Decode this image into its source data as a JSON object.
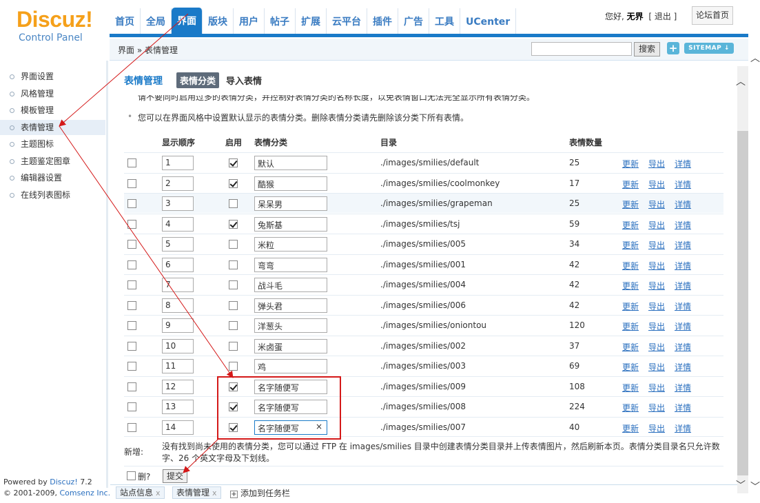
{
  "header": {
    "logo_main": "Discuz!",
    "logo_sub": "Control Panel",
    "nav": [
      "首页",
      "全局",
      "界面",
      "版块",
      "用户",
      "帖子",
      "扩展",
      "云平台",
      "插件",
      "广告",
      "工具",
      "UCenter"
    ],
    "active_nav": "界面",
    "greeting": "您好,",
    "username": "无界",
    "logout_open": "[",
    "logout": "退出",
    "logout_close": "]",
    "forum_home": "论坛首页",
    "accent_color": "#1a7ac8"
  },
  "toolbar": {
    "breadcrumb": "界面 » 表情管理",
    "search_value": "",
    "search_button": "搜索",
    "add_icon": "plus-icon",
    "add_glyph": "+",
    "sitemap": "SITEMAP ↓"
  },
  "sidebar": {
    "items": [
      "界面设置",
      "风格管理",
      "模板管理",
      "表情管理",
      "主题图标",
      "主题鉴定图章",
      "编辑器设置",
      "在线列表图标"
    ],
    "active": "表情管理",
    "powered_prefix": "Powered by",
    "powered_brand": "Discuz!",
    "powered_version": "7.2",
    "copyright_prefix": "© 2001-2009,",
    "copyright_brand": "Comsenz Inc."
  },
  "main": {
    "title": "表情管理",
    "tab_active": "表情分类",
    "tab_other": "导入表情",
    "tip1": "请不要同时启用过多的表情分类，并控制好表情分类的名称长度，以免表情窗口无法完全显示所有表情分类。",
    "tip2": "您可以在界面风格中设置默认显示的表情分类。删除表情分类请先删除该分类下所有表情。",
    "columns": [
      "显示顺序",
      "启用",
      "表情分类",
      "目录",
      "表情数量"
    ],
    "actions": [
      "更新",
      "导出",
      "详情"
    ],
    "rows": [
      {
        "order": "1",
        "enabled": true,
        "name": "默认",
        "dir": "./images/smilies/default",
        "count": "25"
      },
      {
        "order": "2",
        "enabled": true,
        "name": "酷猴",
        "dir": "./images/smilies/coolmonkey",
        "count": "17"
      },
      {
        "order": "3",
        "enabled": false,
        "name": "呆呆男",
        "dir": "./images/smilies/grapeman",
        "count": "25"
      },
      {
        "order": "4",
        "enabled": true,
        "name": "兔斯基",
        "dir": "./images/smilies/tsj",
        "count": "59"
      },
      {
        "order": "5",
        "enabled": false,
        "name": "米粒",
        "dir": "./images/smilies/005",
        "count": "34"
      },
      {
        "order": "6",
        "enabled": false,
        "name": "弯弯",
        "dir": "./images/smilies/001",
        "count": "42"
      },
      {
        "order": "7",
        "enabled": false,
        "name": "战斗毛",
        "dir": "./images/smilies/004",
        "count": "42"
      },
      {
        "order": "8",
        "enabled": false,
        "name": "弹头君",
        "dir": "./images/smilies/006",
        "count": "42"
      },
      {
        "order": "9",
        "enabled": false,
        "name": "洋葱头",
        "dir": "./images/smilies/oniontou",
        "count": "120"
      },
      {
        "order": "10",
        "enabled": false,
        "name": "米卤蛋",
        "dir": "./images/smilies/002",
        "count": "37"
      },
      {
        "order": "11",
        "enabled": false,
        "name": "鸡",
        "dir": "./images/smilies/003",
        "count": "69"
      },
      {
        "order": "12",
        "enabled": true,
        "name": "名字随便写",
        "dir": "./images/smilies/009",
        "count": "108"
      },
      {
        "order": "13",
        "enabled": true,
        "name": "名字随便写",
        "dir": "./images/smilies/008",
        "count": "224"
      },
      {
        "order": "14",
        "enabled": true,
        "name": "名字随便写",
        "dir": "./images/smilies/007",
        "count": "40",
        "focused": true,
        "clear_glyph": "×"
      }
    ],
    "add_label": "新增:",
    "add_text": "没有找到尚未使用的表情分类，您可以通过 FTP 在 images/smilies 目录中创建表情分类目录并上传表情图片，然后刷新本页。表情分类目录名只允许数字、26 个英文字母及下划线。",
    "delete_label": "删?",
    "submit": "提交"
  },
  "taskbar": {
    "tasks": [
      "站点信息",
      "表情管理"
    ],
    "close_glyph": "x",
    "add": "添加到任务栏",
    "add_glyph": "+"
  },
  "scroll": {
    "up_glyph": "︿",
    "down_glyph": "﹀"
  },
  "annotation_color": "#d41818"
}
